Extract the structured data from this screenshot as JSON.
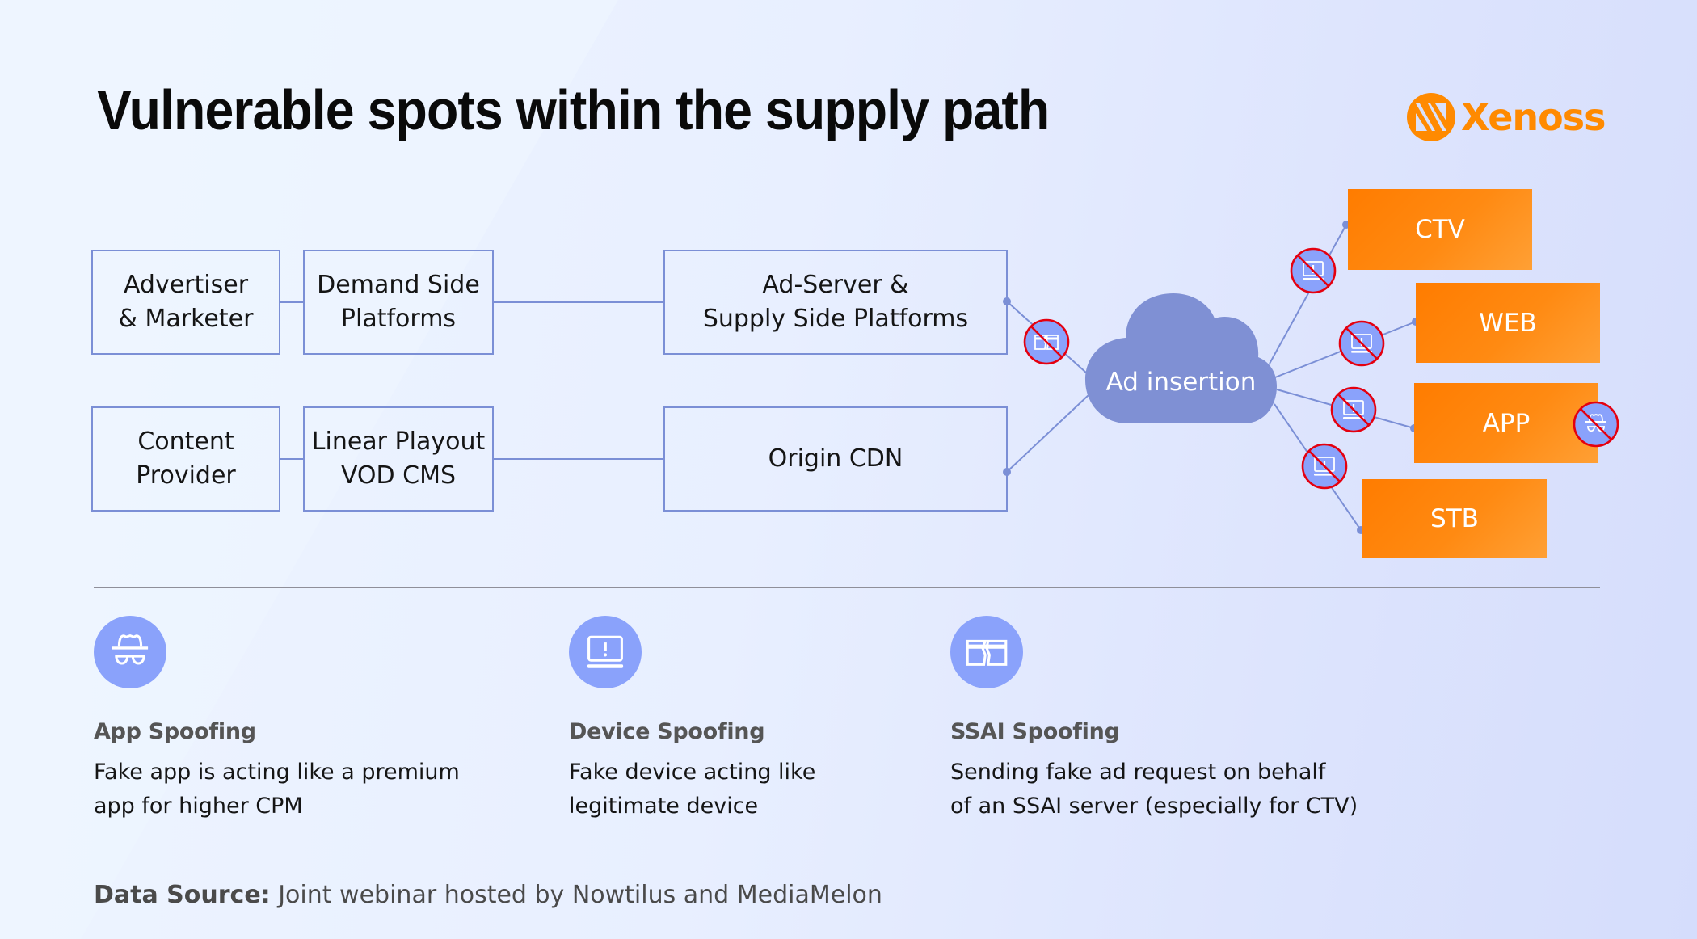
{
  "title": "Vulnerable spots within the supply path",
  "logo": {
    "text": "Xenoss",
    "icon": "xenoss-logo-icon",
    "color": "#ff8a00"
  },
  "flow": {
    "row1": [
      "Advertiser\n& Marketer",
      "Demand Side\nPlatforms",
      "Ad-Server &\nSupply Side Platforms"
    ],
    "row2": [
      "Content\nProvider",
      "Linear Playout\nVOD CMS",
      "Origin CDN"
    ],
    "hub": "Ad insertion",
    "endpoints": [
      "CTV",
      "WEB",
      "APP",
      "STB"
    ]
  },
  "threat_markers": [
    {
      "location": "ad-server-to-ad-insertion",
      "icon": "ssai-spoofing-blocked-icon"
    },
    {
      "location": "ad-insertion-to-ctv",
      "icon": "device-spoofing-blocked-icon"
    },
    {
      "location": "ad-insertion-to-web",
      "icon": "device-spoofing-blocked-icon"
    },
    {
      "location": "ad-insertion-to-app",
      "icon": "device-spoofing-blocked-icon"
    },
    {
      "location": "ad-insertion-to-stb",
      "icon": "device-spoofing-blocked-icon"
    },
    {
      "location": "app",
      "icon": "app-spoofing-blocked-icon"
    }
  ],
  "features": [
    {
      "title": "App Spoofing",
      "description": "Fake app is acting like a premium\napp for higher CPM",
      "icon": "spy-incognito-icon"
    },
    {
      "title": "Device Spoofing",
      "description": "Fake device acting like\nlegitimate device",
      "icon": "laptop-alert-icon"
    },
    {
      "title": "SSAI Spoofing",
      "description": "Sending fake ad request on behalf\nof an SSAI server (especially for CTV)",
      "icon": "broken-card-icon"
    }
  ],
  "source": {
    "label": "Data Source:",
    "text": " Joint webinar hosted by Nowtilus and MediaMelon"
  },
  "colors": {
    "accent": "#ff8a00",
    "node_border": "#7b8fd6",
    "cloud": "#7f90d4",
    "icon_bg": "#8aa2fb",
    "prohibit": "#e5000f"
  }
}
